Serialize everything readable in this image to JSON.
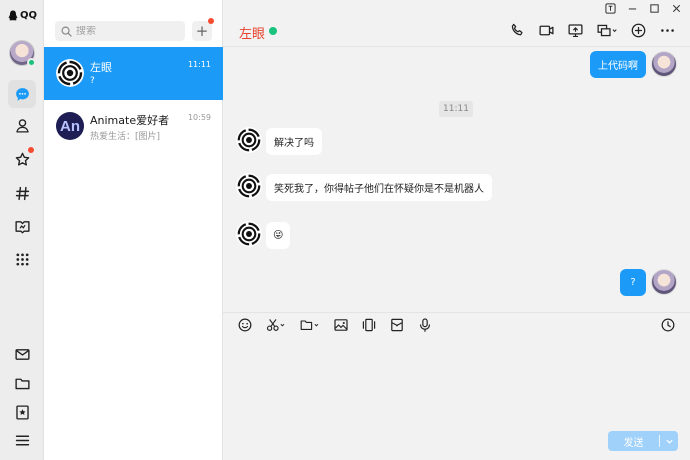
{
  "app": {
    "brand": "QQ"
  },
  "nav": {
    "items": [
      {
        "icon": "chat-bubble-icon",
        "active": true
      },
      {
        "icon": "contacts-icon"
      },
      {
        "icon": "star-icon",
        "badge": true
      },
      {
        "icon": "channel-hash-icon"
      },
      {
        "icon": "book-icon"
      },
      {
        "icon": "app-grid-icon"
      }
    ],
    "bottom": [
      {
        "icon": "mail-icon"
      },
      {
        "icon": "folder-icon"
      },
      {
        "icon": "favorites-icon"
      },
      {
        "icon": "menu-icon"
      }
    ]
  },
  "search": {
    "placeholder": "搜索"
  },
  "list": {
    "add_label": "+",
    "conversations": [
      {
        "name": "左眼",
        "time": "11:11",
        "preview": "?",
        "active": true
      },
      {
        "name": "Animate爱好者",
        "time": "10:59",
        "preview": "热爱生活：[图片]",
        "avatar_text": "An"
      }
    ]
  },
  "chat": {
    "title": "左眼",
    "status_color": "#19c37d",
    "timestamp": "11:11",
    "messages": [
      {
        "side": "out",
        "text": "上代码啊"
      },
      {
        "side": "in",
        "text": "解决了吗"
      },
      {
        "side": "in",
        "text": "笑死我了，你得帖子他们在怀疑你是不是机器人"
      },
      {
        "side": "in",
        "text": "😜"
      },
      {
        "side": "out",
        "text": "?"
      }
    ],
    "send_label": "发送"
  },
  "colors": {
    "accent": "#1b9bf7",
    "title_red": "#e8432d",
    "online_green": "#19c37d",
    "badge_red": "#f74c30"
  }
}
